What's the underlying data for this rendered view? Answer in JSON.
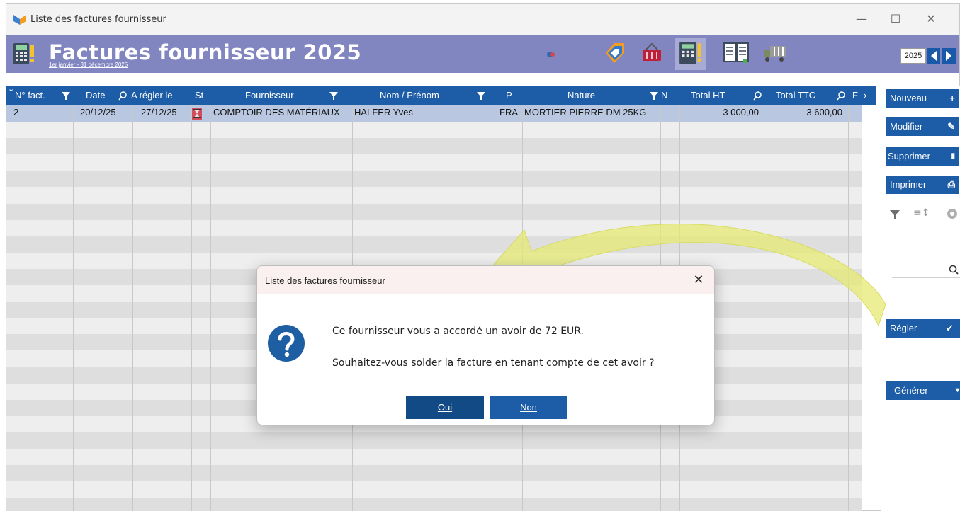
{
  "window": {
    "title": "Liste des factures fournisseur",
    "controls": {
      "minimize": "—",
      "maximize": "☐",
      "close": "✕"
    }
  },
  "header": {
    "title": "Factures fournisseur 2025",
    "subtitle": "1er janvier - 31 décembre 2025",
    "year": "2025",
    "toolbar_icons": [
      "calculator-icon",
      "tag-icon",
      "basket-icon",
      "invoice-icon",
      "ledger-icon",
      "truck-icon"
    ]
  },
  "table": {
    "columns": [
      {
        "label": "N° fact.",
        "filter": true
      },
      {
        "label": "Date",
        "search": true
      },
      {
        "label": "A régler le"
      },
      {
        "label": "St"
      },
      {
        "label": "Fournisseur",
        "filter": true
      },
      {
        "label": "Nom / Prénom",
        "filter": true
      },
      {
        "label": "P"
      },
      {
        "label": "Nature",
        "filter": true
      },
      {
        "label": "N"
      },
      {
        "label": "Total HT",
        "search": true
      },
      {
        "label": "Total TTC",
        "search": true
      },
      {
        "label": "F"
      }
    ],
    "rows": [
      {
        "num": "2",
        "date": "20/12/25",
        "due": "27/12/25",
        "status": "hourglass",
        "supplier": "COMPTOIR DES MATÉRIAUX",
        "name": "HALFER Yves",
        "p": "FRA",
        "nature": "MORTIER PIERRE DM 25KG",
        "n": "",
        "total_ht": "3 000,00",
        "total_ttc": "3 600,00"
      }
    ],
    "empty_rows": 24
  },
  "sidebar": {
    "buttons": [
      {
        "label": "Nouveau",
        "glyph": "+"
      },
      {
        "label": "Modifier",
        "glyph": "✎"
      },
      {
        "label": "Supprimer",
        "glyph": "🗑"
      },
      {
        "label": "Imprimer",
        "glyph": "⎙"
      }
    ],
    "regler": {
      "label": "Régler",
      "glyph": "✓"
    },
    "generer": {
      "label": "Générer",
      "glyph": "▾"
    }
  },
  "dialog": {
    "title": "Liste des factures fournisseur",
    "close": "✕",
    "line1": "Ce fournisseur vous a accordé un avoir de 72 EUR.",
    "line2": "Souhaitez-vous solder la facture en tenant compte de cet avoir ?",
    "yes_label": "Oui",
    "no_label": "Non",
    "icon": "question-icon"
  },
  "colors": {
    "banner": "#8185c0",
    "primary": "#1d5ca6",
    "row_selected": "#b9c8e0",
    "status_red": "#d24d5b",
    "arrow_yellow": "#e6ea73"
  }
}
